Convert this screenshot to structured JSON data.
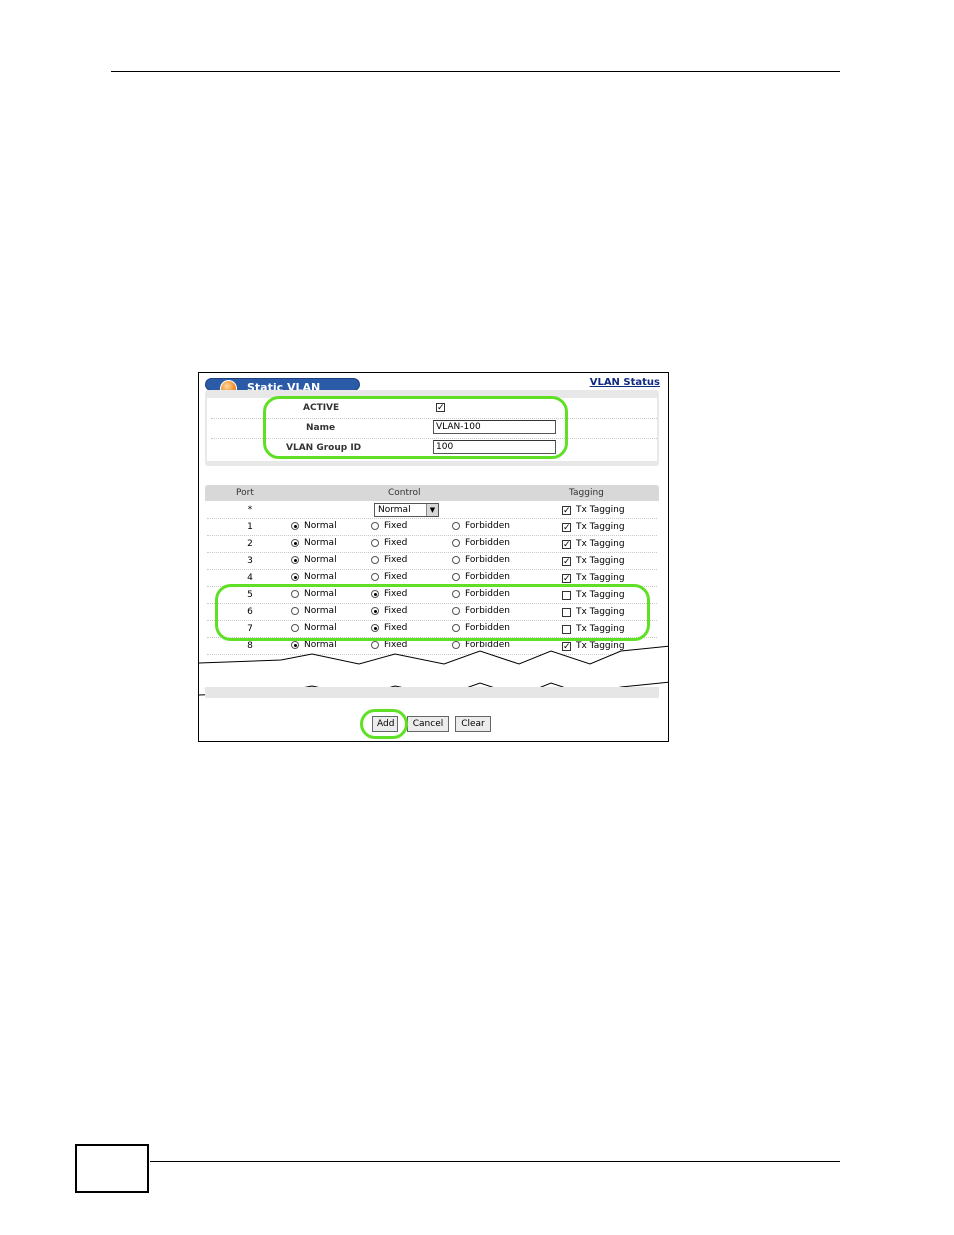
{
  "window": {
    "title": "Static VLAN",
    "status_link": "VLAN Status"
  },
  "form": {
    "active_label": "ACTIVE",
    "active_checked": true,
    "name_label": "Name",
    "name_value": "VLAN-100",
    "group_label": "VLAN Group ID",
    "group_value": "100"
  },
  "table": {
    "headers": {
      "port": "Port",
      "control": "Control",
      "tagging": "Tagging"
    },
    "all_row": {
      "port": "*",
      "control_select": "Normal",
      "tagging_label": "Tx Tagging",
      "tagging_checked": true
    },
    "option_labels": {
      "normal": "Normal",
      "fixed": "Fixed",
      "forbidden": "Forbidden",
      "tagging": "Tx Tagging"
    },
    "rows": [
      {
        "port": "1",
        "control": "normal",
        "tx": true
      },
      {
        "port": "2",
        "control": "normal",
        "tx": true
      },
      {
        "port": "3",
        "control": "normal",
        "tx": true
      },
      {
        "port": "4",
        "control": "normal",
        "tx": true
      },
      {
        "port": "5",
        "control": "fixed",
        "tx": false
      },
      {
        "port": "6",
        "control": "fixed",
        "tx": false
      },
      {
        "port": "7",
        "control": "fixed",
        "tx": false
      },
      {
        "port": "8",
        "control": "normal",
        "tx": true
      }
    ]
  },
  "buttons": {
    "add": "Add",
    "cancel": "Cancel",
    "clear": "Clear"
  },
  "icons": {
    "title": "orange-circle-icon",
    "dropdown": "chevron-down-icon"
  },
  "colors": {
    "highlight": "#5fe025",
    "title_bar": "#2b5aa7"
  }
}
